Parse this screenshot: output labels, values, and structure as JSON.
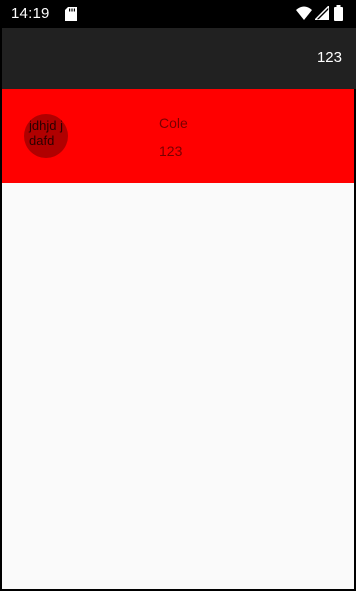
{
  "status_bar": {
    "time": "14:19",
    "icons": [
      "sd-card-icon",
      "wifi-icon",
      "cell-signal-icon",
      "battery-icon"
    ]
  },
  "app_bar": {
    "title": "123"
  },
  "list": {
    "items": [
      {
        "avatar_text": "jdhjd jdafd",
        "name": "Cole",
        "subtitle": "123"
      }
    ]
  },
  "colors": {
    "app_bar": "#212121",
    "list_item_background": "#ff0000",
    "avatar_background": "#b00000",
    "content_background": "#fafafa"
  }
}
